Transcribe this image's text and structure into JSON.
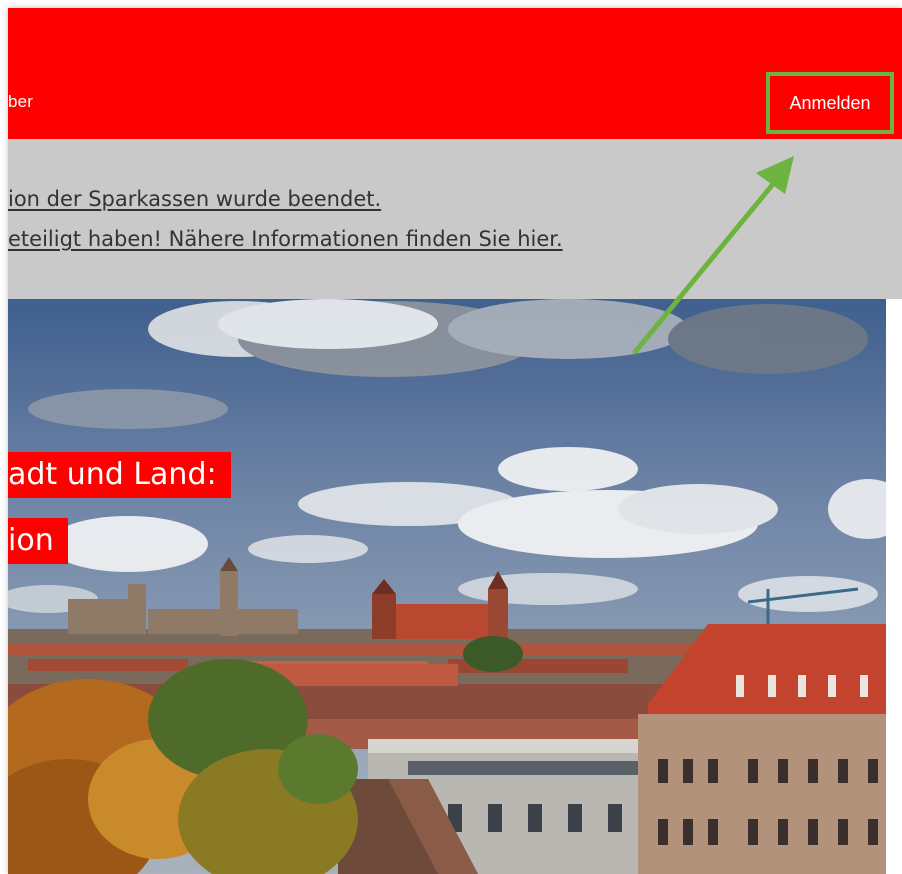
{
  "header": {
    "nav_partial": "ber",
    "login_label": "Anmelden"
  },
  "notice": {
    "line1": "ion der Sparkassen wurde beendet.",
    "line2": "eteiligt haben! Nähere Informationen finden Sie hier."
  },
  "hero": {
    "headline_line1": "adt und Land:",
    "headline_line2": "ion"
  },
  "colors": {
    "brand_red": "#ff0000",
    "notice_gray": "#c9c9c9",
    "highlight_green": "#6cb33f"
  },
  "icons": {
    "annotation": "arrow-up-right-icon"
  }
}
